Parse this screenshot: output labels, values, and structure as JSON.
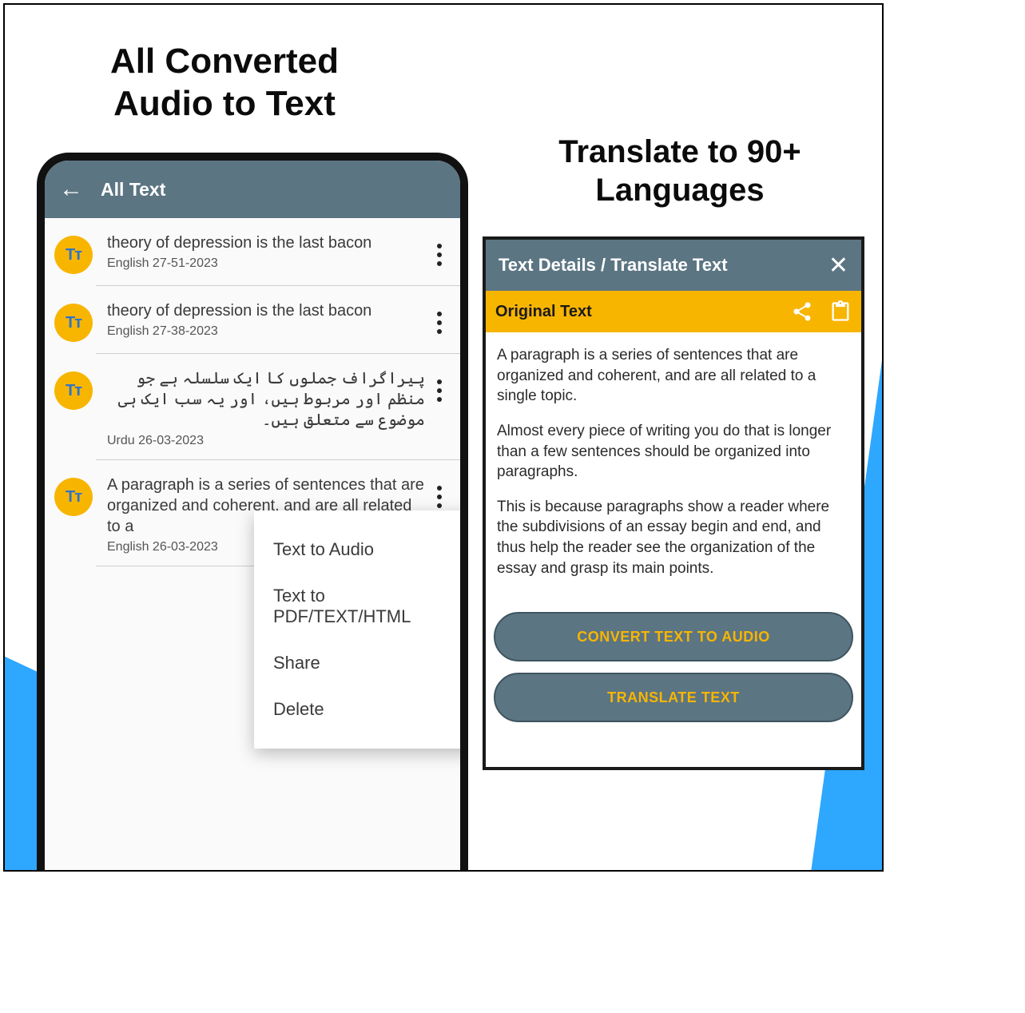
{
  "headings": {
    "left_line1": "All  Converted",
    "left_line2": "Audio to Text",
    "right_line1": "Translate to 90+",
    "right_line2": "Languages"
  },
  "left_screen": {
    "app_bar_title": "All Text",
    "items": [
      {
        "title": "theory of depression is the last bacon",
        "meta": "English  27-51-2023",
        "rtl": false
      },
      {
        "title": "theory of depression is the last bacon",
        "meta": "English  27-38-2023",
        "rtl": false
      },
      {
        "title": "پیراگراف جملوں کا ایک سلسلہ ہے جو منظم اور مربوط ہیں، اور یہ سب ایک ہی موضوع سے متعلق ہیں۔",
        "meta": "Urdu  26-03-2023",
        "rtl": true
      },
      {
        "title": "A paragraph is a series of sentences that are organized and coherent, and are all related to a",
        "meta": "English  26-03-2023",
        "rtl": false
      }
    ],
    "popup": {
      "text_to_audio": "Text to Audio",
      "text_to_export": "Text to PDF/TEXT/HTML",
      "share": "Share",
      "delete": "Delete"
    },
    "avatar_glyph": "Tᴛ"
  },
  "right_screen": {
    "header_title": "Text Details / Translate Text",
    "section_label": "Original Text",
    "para1": "A paragraph is a series of sentences that are organized and coherent, and are all related to a single topic.",
    "para2": "Almost every piece of writing you do that is longer than a few sentences should be organized into paragraphs.",
    "para3": "This is because paragraphs show a reader where the subdivisions of an essay begin and end, and thus help the reader see the organization of the essay and grasp its main points.",
    "btn_convert": "CONVERT TEXT TO AUDIO",
    "btn_translate": "TRANSLATE TEXT"
  }
}
